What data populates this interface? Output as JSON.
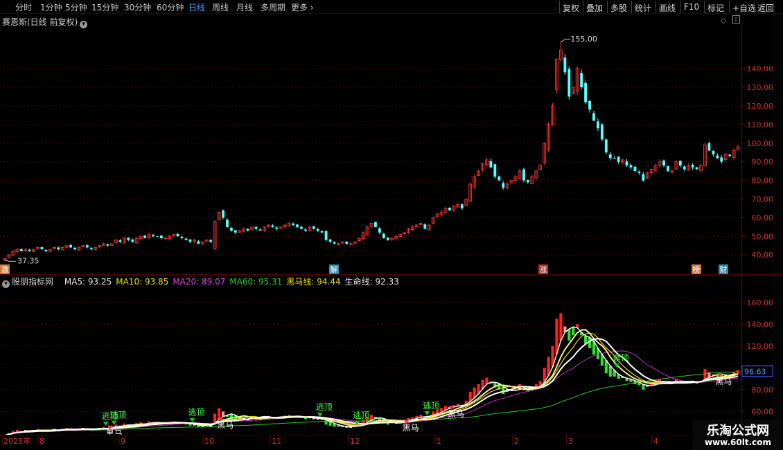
{
  "toolbar": {
    "periods": [
      "分时",
      "1分钟",
      "5分钟",
      "15分钟",
      "30分钟",
      "60分钟",
      "日线",
      "周线",
      "月线",
      "多周期",
      "更多"
    ],
    "active_period": "日线",
    "tools": [
      "复权",
      "叠加",
      "多股",
      "统计",
      "画线",
      "F10",
      "标记",
      "+自选",
      "返回"
    ]
  },
  "main_panel": {
    "title": "赛恩斯(日线 前复权)",
    "high_label": "155.00",
    "low_label": "37.35",
    "event_markers": [
      {
        "label": "激",
        "color": "#c87a3a"
      },
      {
        "label": "解",
        "color": "#2a8aa8"
      },
      {
        "label": "涨",
        "color": "#b03030"
      },
      {
        "label": "榜",
        "color": "#c87a3a"
      },
      {
        "label": "财",
        "color": "#2a8aa8"
      }
    ],
    "y_ticks": [
      "140.00",
      "130.00",
      "120.00",
      "110.00",
      "100.00",
      "90.00",
      "80.00",
      "70.00",
      "60.00",
      "50.00",
      "40.00"
    ]
  },
  "indicator_panel": {
    "name": "股朋指标网",
    "legend": [
      {
        "text": "MA5: 93.25",
        "color": "#e8e8e8"
      },
      {
        "text": "MA10: 93.85",
        "color": "#f0e000"
      },
      {
        "text": "MA20: 89.07",
        "color": "#e040e0"
      },
      {
        "text": "MA60: 95.31",
        "color": "#20d020"
      },
      {
        "text": "黑马线: 94.44",
        "color": "#f0e000"
      },
      {
        "text": "生命线: 92.33",
        "color": "#e8e8e8"
      }
    ],
    "y_ticks": [
      "160.00",
      "140.00",
      "120.00",
      "100.00",
      "80.00",
      "60.00"
    ],
    "current_value": "96.63",
    "signal_escape": "逃顶",
    "signal_horse": "黑马"
  },
  "time_axis": {
    "labels": [
      "2025年",
      "8",
      "9",
      "10",
      "11",
      "12",
      "1",
      "2",
      "3",
      "4"
    ]
  },
  "watermark": {
    "line1": "乐淘公式网",
    "line2": "www.60lt.com"
  },
  "colors": {
    "up": "#e83030",
    "down": "#54ffff",
    "active": "#4aa3ff",
    "grid": "#5a0000"
  },
  "chart_data": {
    "type": "candlestick",
    "x_start": "2025-07",
    "price_range": [
      35,
      158
    ],
    "y_grid_step": 10,
    "high": 155.0,
    "low": 37.35,
    "closes": [
      38,
      40,
      42,
      43,
      42,
      43,
      42,
      43,
      44,
      43,
      42,
      43,
      44,
      43,
      44,
      45,
      44,
      43,
      44,
      45,
      44,
      43,
      44,
      45,
      46,
      45,
      46,
      48,
      47,
      49,
      48,
      47,
      49,
      50,
      49,
      51,
      50,
      50,
      49,
      49,
      50,
      51,
      50,
      49,
      48,
      47,
      48,
      46,
      47,
      48,
      47,
      58,
      63,
      60,
      55,
      53,
      52,
      53,
      54,
      53,
      55,
      54,
      53,
      55,
      56,
      55,
      54,
      55,
      56,
      57,
      56,
      55,
      54,
      53,
      55,
      54,
      53,
      52,
      48,
      47,
      46,
      46,
      47,
      46,
      46,
      47,
      49,
      52,
      55,
      57,
      55,
      52,
      49,
      48,
      49,
      50,
      51,
      52,
      54,
      55,
      56,
      57,
      54,
      56,
      60,
      62,
      63,
      65,
      64,
      66,
      67,
      65,
      70,
      78,
      82,
      85,
      89,
      91,
      87,
      82,
      80,
      76,
      78,
      80,
      82,
      85,
      80,
      79,
      82,
      85,
      88,
      100,
      110,
      120,
      145,
      150,
      138,
      125,
      130,
      140,
      130,
      122,
      118,
      112,
      108,
      102,
      95,
      92,
      92,
      90,
      91,
      88,
      87,
      85,
      84,
      80,
      84,
      86,
      88,
      90,
      88,
      85,
      85,
      90,
      88,
      86,
      88,
      87,
      86,
      88,
      99,
      96,
      94,
      92,
      90,
      94,
      93,
      96,
      98
    ],
    "ma_series": [
      "MA5",
      "MA10",
      "MA20",
      "MA60",
      "黑马线",
      "生命线"
    ],
    "last_values": {
      "MA5": 93.25,
      "MA10": 93.85,
      "MA20": 89.07,
      "MA60": 95.31,
      "黑马线": 94.44,
      "生命线": 92.33
    }
  }
}
